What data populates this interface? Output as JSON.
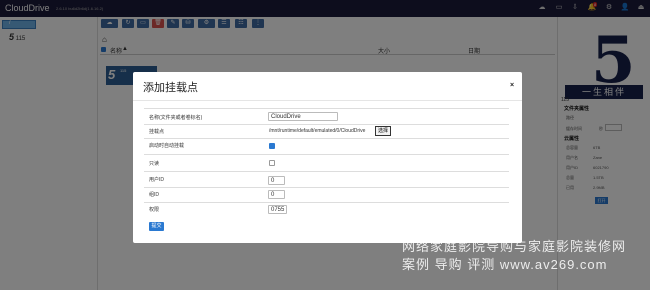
{
  "app": {
    "title": "CloudDrive",
    "version": "2.6.10 bu6d2b6d(1.6.16.2)",
    "notification_count": "8"
  },
  "toolbar": {
    "icons": [
      "cloud-icon",
      "refresh-icon",
      "monitor-icon",
      "delete-icon",
      "edit-icon",
      "mount-icon",
      "settings-icon",
      "list-icon",
      "grid-icon",
      "more-icon"
    ]
  },
  "sidebar": {
    "root_label": "/",
    "node_label": "115"
  },
  "breadcrumb": {
    "home_icon": "home-icon"
  },
  "table": {
    "columns": {
      "name": "名称",
      "sort": "▲",
      "size": "大小",
      "date": "日期"
    }
  },
  "file": {
    "thumb_text": "5",
    "thumb_sub": "115"
  },
  "right_panel": {
    "poster_big": "5",
    "poster_caption": "一生相伴",
    "folder_label": "115",
    "file_props_title": "文件夹属性",
    "rows": [
      {
        "k": "路径"
      },
      {
        "k": "缓存时间",
        "v": "秒"
      }
    ],
    "cloud_title": "云属性",
    "cloud_rows": [
      {
        "k": "总容量",
        "v": "6TB"
      },
      {
        "k": "用户名",
        "v": "Zane"
      },
      {
        "k": "用户ID",
        "v": "6021790"
      },
      {
        "k": "总量",
        "v": "1.5TB"
      },
      {
        "k": "已用",
        "v": "2.9MB"
      }
    ],
    "open_label": "打开"
  },
  "modal": {
    "title": "添加挂载点",
    "close_label": "×",
    "rows": {
      "name_label": "名称(文件夹或者卷标名)",
      "name_value": "CloudDrive",
      "mount_label": "挂载点",
      "mount_path": "/mnt/runtime/default/emulated/0/CloudDrive",
      "select_label": "选择",
      "autostart_label": "启动时自动挂载",
      "readonly_label": "只读",
      "uid_label": "用户ID",
      "uid_value": "0",
      "gid_label": "组ID",
      "gid_value": "0",
      "perm_label": "权限",
      "perm_value": "0755"
    },
    "autostart_checked": true,
    "readonly_checked": false,
    "save_label": "提交"
  },
  "watermark": {
    "line1": "网络家庭影院导购与家庭影院装修网",
    "line2": "案例  导购  评测   www.av269.com"
  },
  "colors": {
    "topbar": "#1b1a3a",
    "primary": "#2a79d1",
    "danger": "#d9534f"
  }
}
